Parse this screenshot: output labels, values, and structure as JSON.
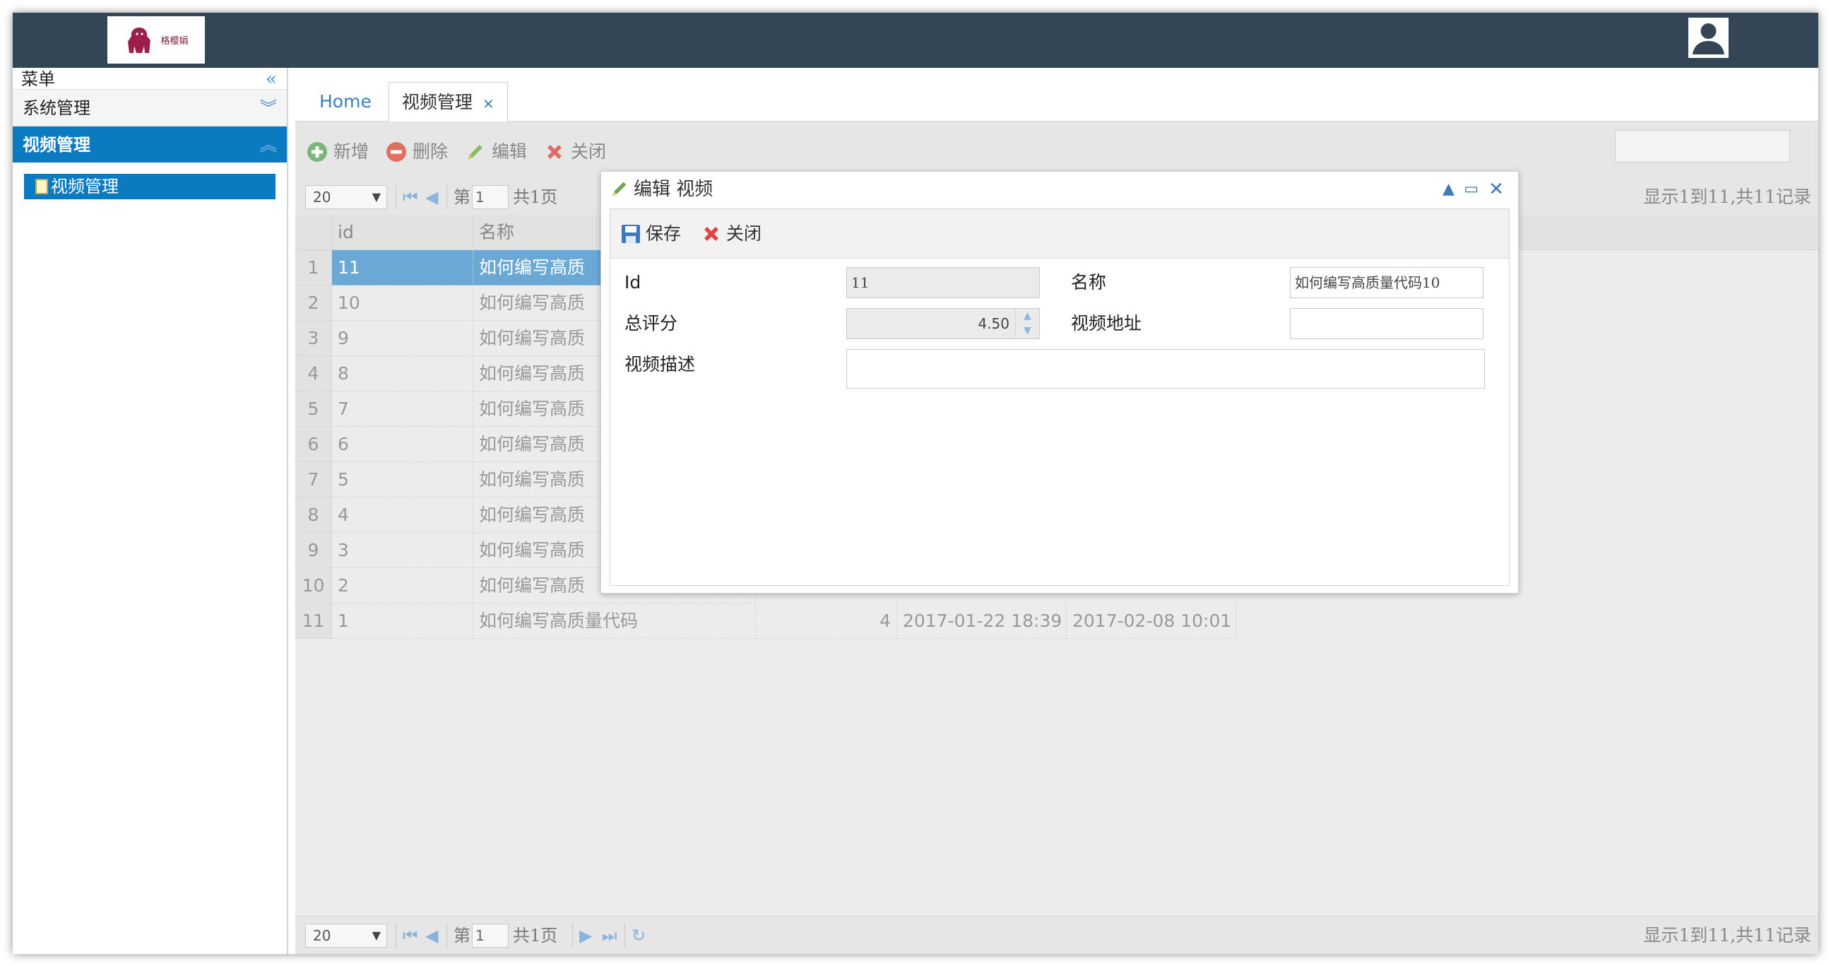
{
  "header": {
    "logo_text": "格樱娟"
  },
  "sidebar": {
    "title": "菜单",
    "sections": [
      {
        "label": "系统管理"
      },
      {
        "label": "视频管理"
      }
    ],
    "tree_item": "视频管理"
  },
  "tabs": [
    {
      "label": "Home"
    },
    {
      "label": "视频管理",
      "close": "×"
    }
  ],
  "toolbar": {
    "add": "新增",
    "delete": "删除",
    "edit": "编辑",
    "close": "关闭"
  },
  "pager": {
    "page_size": "20",
    "page_prefix": "第",
    "page_number": "1",
    "page_suffix": "共1页",
    "page_suffix_truncated": "共1页",
    "info": "显示1到11,共11记录"
  },
  "grid": {
    "columns": {
      "id": "id",
      "name": "名称"
    },
    "rows": [
      {
        "n": "1",
        "id": "11",
        "name": "如何编写高质"
      },
      {
        "n": "2",
        "id": "10",
        "name": "如何编写高质"
      },
      {
        "n": "3",
        "id": "9",
        "name": "如何编写高质"
      },
      {
        "n": "4",
        "id": "8",
        "name": "如何编写高质"
      },
      {
        "n": "5",
        "id": "7",
        "name": "如何编写高质"
      },
      {
        "n": "6",
        "id": "6",
        "name": "如何编写高质"
      },
      {
        "n": "7",
        "id": "5",
        "name": "如何编写高质"
      },
      {
        "n": "8",
        "id": "4",
        "name": "如何编写高质"
      },
      {
        "n": "9",
        "id": "3",
        "name": "如何编写高质"
      },
      {
        "n": "10",
        "id": "2",
        "name": "如何编写高质"
      },
      {
        "n": "11",
        "id": "1",
        "name": "如何编写高质量代码",
        "score": "4",
        "created": "2017-01-22 18:39",
        "updated": "2017-02-08 10:01"
      }
    ]
  },
  "dialog": {
    "title": "编辑 视频",
    "save": "保存",
    "close": "关闭",
    "fields": {
      "id_label": "Id",
      "id_value": "11",
      "name_label": "名称",
      "name_value": "如何编写高质量代码10",
      "score_label": "总评分",
      "score_value": "4.50",
      "url_label": "视频地址",
      "url_value": "",
      "desc_label": "视频描述",
      "desc_value": ""
    }
  },
  "colors": {
    "header_bg": "#344556",
    "accent": "#0a7bc1",
    "selected_row": "#6aa8d6"
  }
}
